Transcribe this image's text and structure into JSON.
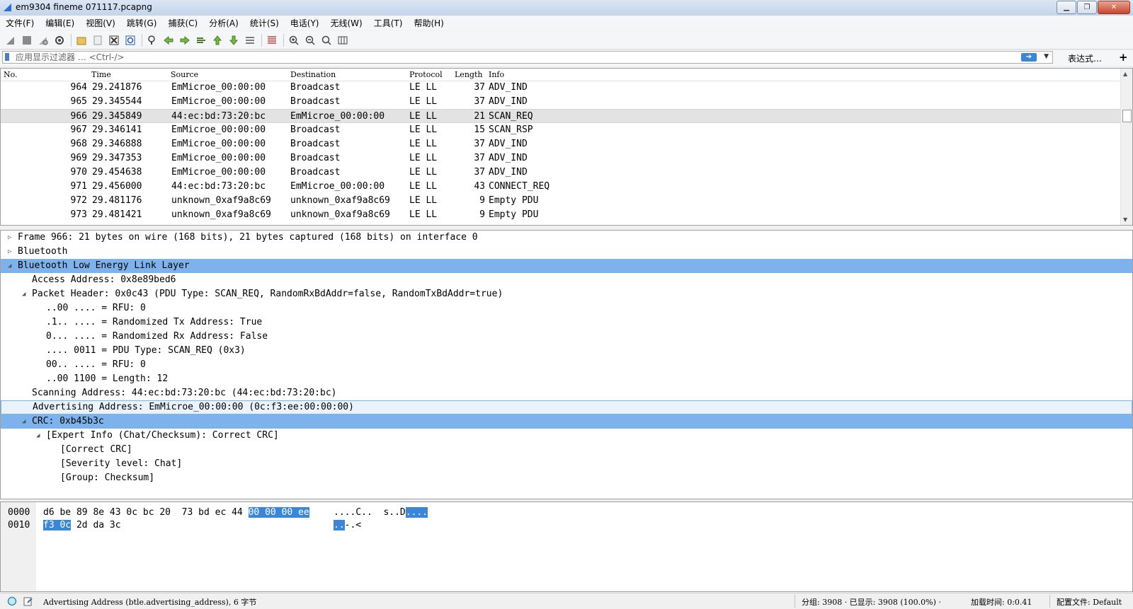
{
  "window": {
    "title": "em9304 fineme 071117.pcapng"
  },
  "menu": [
    "文件(F)",
    "编辑(E)",
    "视图(V)",
    "跳转(G)",
    "捕获(C)",
    "分析(A)",
    "统计(S)",
    "电话(Y)",
    "无线(W)",
    "工具(T)",
    "帮助(H)"
  ],
  "filter": {
    "placeholder": "应用显示过滤器 … <Ctrl-/>",
    "value": "",
    "expression_label": "表达式…",
    "add_label": "+"
  },
  "packet_list": {
    "columns": [
      "No.",
      "Time",
      "Source",
      "Destination",
      "Protocol",
      "Length",
      "Info"
    ],
    "rows": [
      {
        "no": "964",
        "time": "29.241876",
        "src": "EmMicroe_00:00:00",
        "dst": "Broadcast",
        "proto": "LE LL",
        "len": "37",
        "info": "ADV_IND"
      },
      {
        "no": "965",
        "time": "29.345544",
        "src": "EmMicroe_00:00:00",
        "dst": "Broadcast",
        "proto": "LE LL",
        "len": "37",
        "info": "ADV_IND"
      },
      {
        "no": "966",
        "time": "29.345849",
        "src": "44:ec:bd:73:20:bc",
        "dst": "EmMicroe_00:00:00",
        "proto": "LE LL",
        "len": "21",
        "info": "SCAN_REQ",
        "selected": true
      },
      {
        "no": "967",
        "time": "29.346141",
        "src": "EmMicroe_00:00:00",
        "dst": "Broadcast",
        "proto": "LE LL",
        "len": "15",
        "info": "SCAN_RSP"
      },
      {
        "no": "968",
        "time": "29.346888",
        "src": "EmMicroe_00:00:00",
        "dst": "Broadcast",
        "proto": "LE LL",
        "len": "37",
        "info": "ADV_IND"
      },
      {
        "no": "969",
        "time": "29.347353",
        "src": "EmMicroe_00:00:00",
        "dst": "Broadcast",
        "proto": "LE LL",
        "len": "37",
        "info": "ADV_IND"
      },
      {
        "no": "970",
        "time": "29.454638",
        "src": "EmMicroe_00:00:00",
        "dst": "Broadcast",
        "proto": "LE LL",
        "len": "37",
        "info": "ADV_IND"
      },
      {
        "no": "971",
        "time": "29.456000",
        "src": "44:ec:bd:73:20:bc",
        "dst": "EmMicroe_00:00:00",
        "proto": "LE LL",
        "len": "43",
        "info": "CONNECT_REQ"
      },
      {
        "no": "972",
        "time": "29.481176",
        "src": "unknown_0xaf9a8c69",
        "dst": "unknown_0xaf9a8c69",
        "proto": "LE LL",
        "len": "9",
        "info": "Empty PDU"
      },
      {
        "no": "973",
        "time": "29.481421",
        "src": "unknown_0xaf9a8c69",
        "dst": "unknown_0xaf9a8c69",
        "proto": "LE LL",
        "len": "9",
        "info": "Empty PDU"
      }
    ]
  },
  "details": [
    {
      "text": "Frame 966: 21 bytes on wire (168 bits), 21 bytes captured (168 bits) on interface 0",
      "level": 0,
      "toggle": "collapsed"
    },
    {
      "text": "Bluetooth",
      "level": 0,
      "toggle": "collapsed"
    },
    {
      "text": "Bluetooth Low Energy Link Layer",
      "level": 0,
      "toggle": "expanded",
      "state": "selected"
    },
    {
      "text": "Access Address: 0x8e89bed6",
      "level": 1
    },
    {
      "text": "Packet Header: 0x0c43 (PDU Type: SCAN_REQ, RandomRxBdAddr=false, RandomTxBdAddr=true)",
      "level": 1,
      "toggle": "expanded"
    },
    {
      "text": "..00 .... = RFU: 0",
      "level": 2
    },
    {
      "text": ".1.. .... = Randomized Tx Address: True",
      "level": 2
    },
    {
      "text": "0... .... = Randomized Rx Address: False",
      "level": 2
    },
    {
      "text": ".... 0011 = PDU Type: SCAN_REQ (0x3)",
      "level": 2
    },
    {
      "text": "00.. .... = RFU: 0",
      "level": 2
    },
    {
      "text": "..00 1100 = Length: 12",
      "level": 2
    },
    {
      "text": "Scanning Address: 44:ec:bd:73:20:bc (44:ec:bd:73:20:bc)",
      "level": 1
    },
    {
      "text": "Advertising Address: EmMicroe_00:00:00 (0c:f3:ee:00:00:00)",
      "level": 1,
      "state": "hover"
    },
    {
      "text": "CRC: 0xb45b3c",
      "level": 1,
      "toggle": "expanded",
      "state": "selected"
    },
    {
      "text": "[Expert Info (Chat/Checksum): Correct CRC]",
      "level": 2,
      "toggle": "expanded"
    },
    {
      "text": "[Correct CRC]",
      "level": 3
    },
    {
      "text": "[Severity level: Chat]",
      "level": 3
    },
    {
      "text": "[Group: Checksum]",
      "level": 3
    }
  ],
  "bytes": [
    {
      "offset": "0000",
      "hex_a": "d6 be 89 8e 43 0c bc 20  73 bd ec 44 ",
      "hex_hl": "00 00 00 ee",
      "ascii_a": "....C..  s..D",
      "ascii_hl": "...."
    },
    {
      "offset": "0010",
      "hex_a": "",
      "hex_hl": "f3 0c",
      "hex_b": " 2d da 3c",
      "ascii_a": "",
      "ascii_hl": "..",
      "ascii_b": "-.<"
    }
  ],
  "status": {
    "field_info": "Advertising Address (btle.advertising_address), 6 字节",
    "packets": "分组: 3908 · 已显示: 3908 (100.0%) ·",
    "load_time": "加载时间: 0:0.41",
    "profile": "配置文件: Default"
  },
  "colors": {
    "selection": "#7eb2ec",
    "byte_highlight": "#3c86d8",
    "row_selected": "#e3e3e3"
  }
}
